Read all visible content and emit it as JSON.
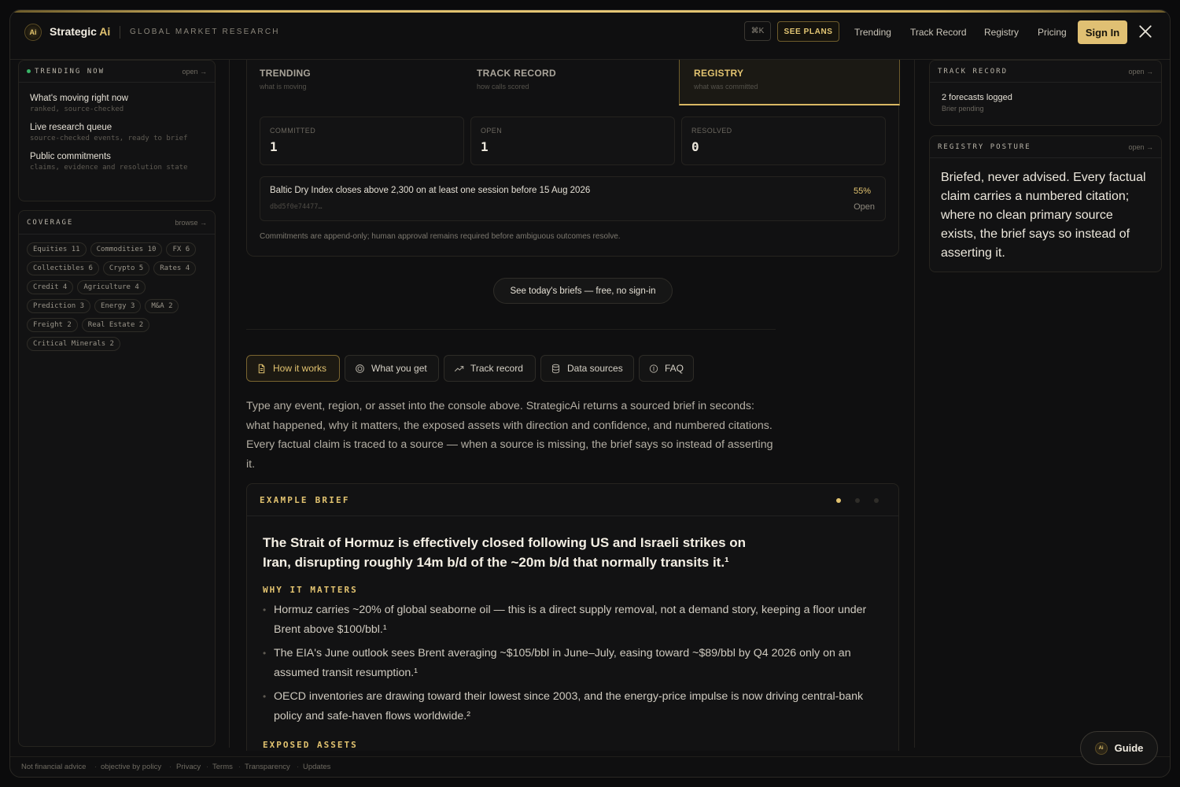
{
  "header": {
    "logo_mark": "Ai",
    "brand_name": "Strategic",
    "brand_ai": "Ai",
    "subtitle": "GLOBAL MARKET RESEARCH",
    "kbd_shortcut": "⌘K",
    "see_plans": "SEE PLANS",
    "nav": [
      "Trending",
      "Track Record",
      "Registry",
      "Pricing"
    ],
    "sign_in": "Sign In",
    "x_icon": "x-logo-icon"
  },
  "left": {
    "trending_title": "TRENDING NOW",
    "trending_link": "open →",
    "trending_items": [
      {
        "title": "What's moving right now",
        "sub": "ranked, source-checked"
      },
      {
        "title": "Live research queue",
        "sub": "source-checked events, ready to brief"
      },
      {
        "title": "Public commitments",
        "sub": "claims, evidence and resolution state"
      }
    ],
    "coverage_title": "COVERAGE",
    "coverage_link": "browse →",
    "coverage_chips": [
      "Equities 11",
      "Commodities 10",
      "FX 6",
      "Collectibles 6",
      "Crypto 5",
      "Rates 4",
      "Credit 4",
      "Agriculture 4",
      "Prediction 3",
      "Energy 3",
      "M&A 2",
      "Freight 2",
      "Real Estate 2",
      "Critical Minerals 2"
    ]
  },
  "registry": {
    "tabs": [
      {
        "label": "TRENDING",
        "sub": "what is moving"
      },
      {
        "label": "TRACK RECORD",
        "sub": "how calls scored"
      },
      {
        "label": "REGISTRY",
        "sub": "what was committed"
      }
    ],
    "stats": [
      {
        "label": "COMMITTED",
        "value": "1"
      },
      {
        "label": "OPEN",
        "value": "1"
      },
      {
        "label": "RESOLVED",
        "value": "0"
      }
    ],
    "commitment": {
      "title": "Baltic Dry Index closes above 2,300 on at least one session before 15 Aug 2026",
      "hash": "dbd5f0e74477…",
      "probability": "55%",
      "status": "Open"
    },
    "note": "Commitments are append-only; human approval remains required before ambiguous outcomes resolve."
  },
  "briefs_button": "See today's briefs — free, no sign-in",
  "info_tabs": [
    {
      "label": "How it works",
      "icon": "document-icon"
    },
    {
      "label": "What you get",
      "icon": "target-icon"
    },
    {
      "label": "Track record",
      "icon": "trend-up-icon"
    },
    {
      "label": "Data sources",
      "icon": "database-icon"
    },
    {
      "label": "FAQ",
      "icon": "help-icon"
    }
  ],
  "intro": "Type any event, region, or asset into the console above. StrategicAi returns a sourced brief in seconds: what happened, why it matters, the exposed assets with direction and confidence, and numbered citations. Every factual claim is traced to a source — when a source is missing, the brief says so instead of asserting it.",
  "example": {
    "label": "EXAMPLE BRIEF",
    "headline": "The Strait of Hormuz is effectively closed following US and Israeli strikes on Iran, disrupting roughly 14m b/d of the ~20m b/d that normally transits it.¹",
    "why_title": "WHY IT MATTERS",
    "bullets": [
      "Hormuz carries ~20% of global seaborne oil — this is a direct supply removal, not a demand story, keeping a floor under Brent above $100/bbl.¹",
      "The EIA's June outlook sees Brent averaging ~$105/bbl in June–July, easing toward ~$89/bbl by Q4 2026 only on an assumed transit resumption.¹",
      "OECD inventories are drawing toward their lowest since 2003, and the energy-price impulse is now driving central-bank policy and safe-haven flows worldwide.²"
    ],
    "exposed_title": "EXPOSED ASSETS"
  },
  "right": {
    "track_title": "TRACK RECORD",
    "track_link": "open →",
    "track_text": "2 forecasts logged",
    "track_sub": "Brier pending",
    "posture_title": "REGISTRY POSTURE",
    "posture_link": "open →",
    "posture_text": "Briefed, never advised. Every factual claim carries a numbered citation; where no clean primary source exists, the brief says so instead of asserting it."
  },
  "footer": {
    "links": [
      "Not financial advice",
      "objective by policy",
      "Privacy",
      "Terms",
      "Transparency",
      "Updates"
    ],
    "separator": "·"
  },
  "guide": {
    "mark": "Ai",
    "label": "Guide"
  }
}
